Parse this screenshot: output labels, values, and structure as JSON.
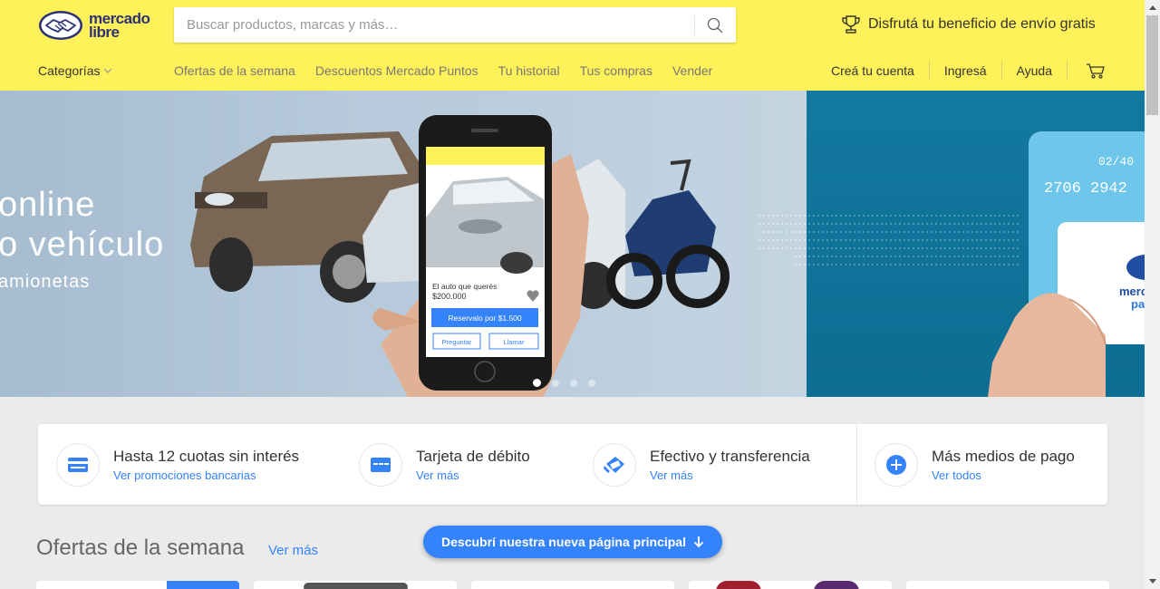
{
  "header": {
    "logo_text_line1": "mercado",
    "logo_text_line2": "libre",
    "search_placeholder": "Buscar productos, marcas y más…",
    "promo_text": "Disfrutá tu beneficio de envío gratis",
    "categories_label": "Categorías",
    "nav_links": [
      "Ofertas de la semana",
      "Descuentos Mercado Puntos",
      "Tu historial",
      "Tus compras",
      "Vender"
    ],
    "user_links": [
      "Creá tu cuenta",
      "Ingresá",
      "Ayuda"
    ],
    "brand_color": "#fff159"
  },
  "banner": {
    "line1": "online",
    "line2": "o vehículo",
    "line3": "amionetas",
    "phone": {
      "listing_title": "El auto que querés",
      "price": "$200.000",
      "reserve_button": "Reservalo por $1.500",
      "ask_button": "Preguntar",
      "call_button": "Llamar"
    },
    "card_number_fragment": "2706 2942",
    "card_expiry_fragment": "02/40",
    "slide_count": 4,
    "active_slide": 1
  },
  "payments": [
    {
      "title": "Hasta 12 cuotas sin interés",
      "link": "Ver promociones bancarias",
      "icon": "credit-card-icon"
    },
    {
      "title": "Tarjeta de débito",
      "link": "Ver más",
      "icon": "debit-card-icon"
    },
    {
      "title": "Efectivo y transferencia",
      "link": "Ver más",
      "icon": "cash-icon"
    },
    {
      "title": "Más medios de pago",
      "link": "Ver todos",
      "icon": "plus-icon"
    }
  ],
  "offers": {
    "title": "Ofertas de la semana",
    "link": "Ver más"
  },
  "floating_button": "Descubrí nuestra nueva página principal",
  "accent_color": "#3483fa"
}
